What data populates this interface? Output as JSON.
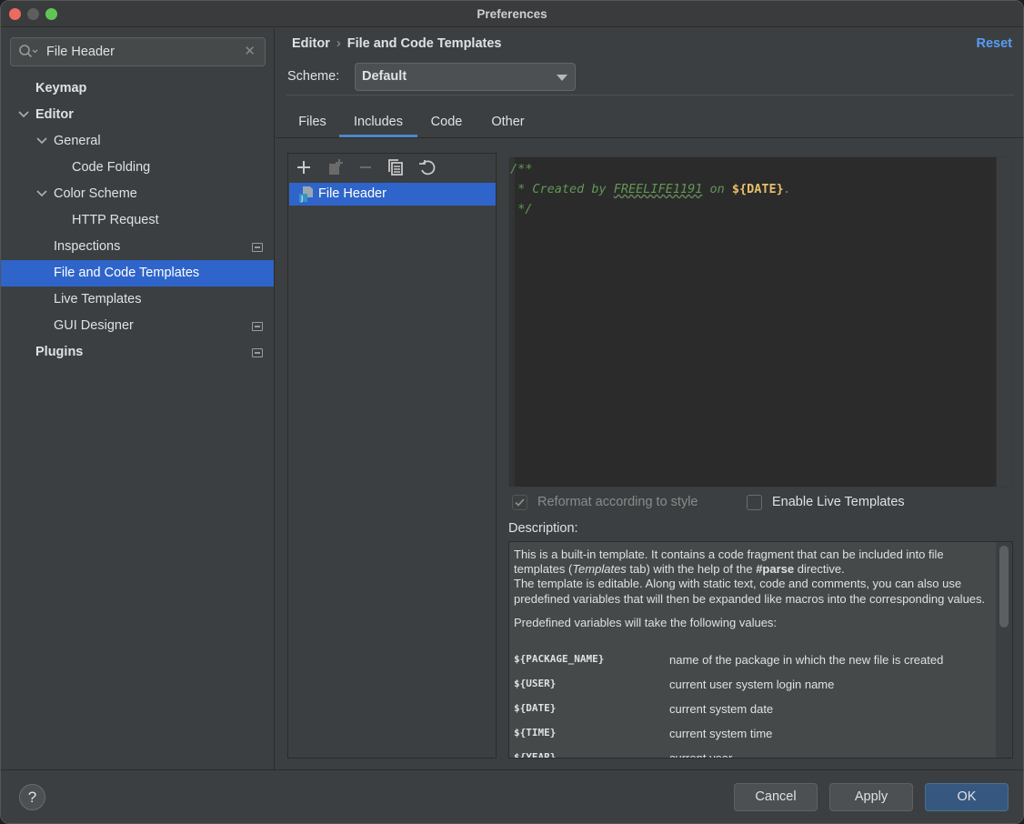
{
  "window": {
    "title": "Preferences"
  },
  "search": {
    "value": "File Header"
  },
  "tree": [
    {
      "label": "Keymap"
    },
    {
      "label": "Editor"
    },
    {
      "label": "General"
    },
    {
      "label": "Code Folding"
    },
    {
      "label": "Color Scheme"
    },
    {
      "label": "HTTP Request"
    },
    {
      "label": "Inspections"
    },
    {
      "label": "File and Code Templates"
    },
    {
      "label": "Live Templates"
    },
    {
      "label": "GUI Designer"
    },
    {
      "label": "Plugins"
    }
  ],
  "breadcrumb": {
    "parent": "Editor",
    "separator": "›",
    "current": "File and Code Templates"
  },
  "reset_label": "Reset",
  "scheme": {
    "label": "Scheme:",
    "value": "Default"
  },
  "tabs": [
    {
      "label": "Files"
    },
    {
      "label": "Includes"
    },
    {
      "label": "Code"
    },
    {
      "label": "Other"
    }
  ],
  "list": {
    "items": [
      {
        "label": "File Header"
      }
    ]
  },
  "editor": {
    "line1": "/**",
    "line2_prefix": " * Created by ",
    "line2_user": "FREELIFE1191",
    "line2_mid": " on ",
    "line2_var": "${DATE}",
    "line2_end": ".",
    "line3": " */"
  },
  "options": {
    "reformat_label": "Reformat according to style",
    "live_templates_label": "Enable Live Templates"
  },
  "description": {
    "label": "Description:",
    "para1_a": "This is a built-in template. It contains a code fragment that can be included into file templates (",
    "para1_em": "Templates",
    "para1_b": " tab) with the help of the ",
    "para1_strong": "#parse",
    "para1_c": " directive.",
    "para2": "The template is editable. Along with static text, code and comments, you can also use predefined variables that will then be expanded like macros into the corresponding values.",
    "para3": "Predefined variables will take the following values:",
    "variables": [
      {
        "name": "${PACKAGE_NAME}",
        "desc": "name of the package in which the new file is created"
      },
      {
        "name": "${USER}",
        "desc": "current user system login name"
      },
      {
        "name": "${DATE}",
        "desc": "current system date"
      },
      {
        "name": "${TIME}",
        "desc": "current system time"
      },
      {
        "name": "${YEAR}",
        "desc": "current year"
      }
    ]
  },
  "footer": {
    "help": "?",
    "cancel": "Cancel",
    "apply": "Apply",
    "ok": "OK"
  }
}
